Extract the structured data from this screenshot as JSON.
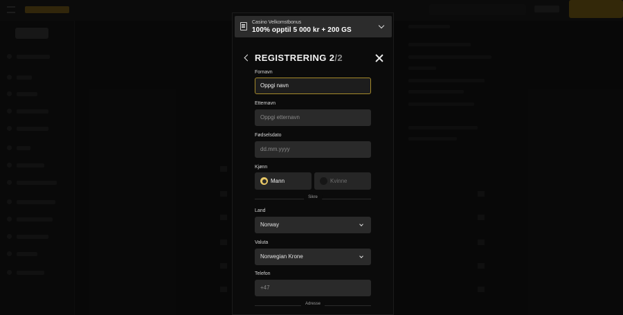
{
  "bonus": {
    "subtitle": "Casino Velkomstbonus",
    "title": "100% opptil 5 000 kr + 200 GS",
    "icon": "voucher-icon"
  },
  "header": {
    "title": "REGISTRERING",
    "step": "2",
    "total": "/2"
  },
  "fields": {
    "first_name": {
      "label": "Fornavn",
      "placeholder": "Oppgi navn"
    },
    "last_name": {
      "label": "Etternavn",
      "placeholder": "Oppgi etternavn"
    },
    "birthdate": {
      "label": "Fødselsdato",
      "placeholder": "dd.mm.yyyy"
    },
    "gender": {
      "label": "Kjønn",
      "options": [
        "Mann",
        "Kvinne"
      ],
      "selected": "Mann"
    },
    "country": {
      "label": "Land",
      "value": "Norway"
    },
    "currency": {
      "label": "Valuta",
      "value": "Norwegian Krone"
    },
    "phone": {
      "label": "Telefon",
      "value": "+47"
    }
  },
  "dividers": {
    "secure": "Sikre",
    "address": "Adresse"
  },
  "colors": {
    "accent": "#e7c766",
    "focus_border": "#a68a2a",
    "field_bg": "#2a2a2a",
    "modal_bg": "#0b0b0b"
  }
}
